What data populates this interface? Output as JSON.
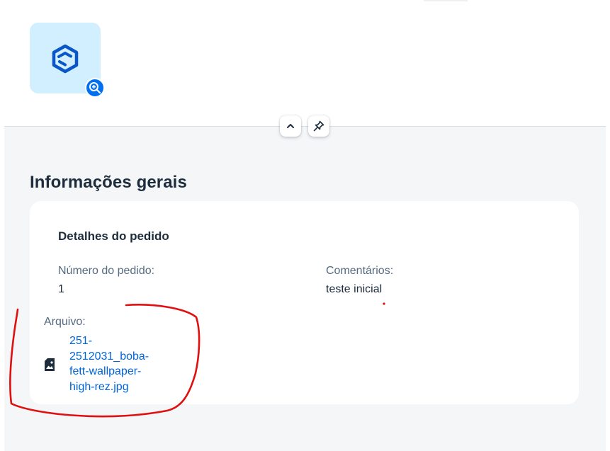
{
  "header": {
    "avatar_icon": "product-box-icon",
    "zoom_icon": "zoom-in-icon",
    "collapse_icon": "chevron-up-icon",
    "pin_icon": "pin-icon"
  },
  "section": {
    "title": "Informações gerais"
  },
  "card": {
    "title": "Detalhes do pedido",
    "fields": {
      "order_number": {
        "label": "Número do pedido:",
        "value": "1"
      },
      "comments": {
        "label": "Comentários:",
        "value": "teste inicial"
      },
      "file": {
        "label": "Arquivo:",
        "icon": "image-file-icon",
        "link_lines": [
          "251-",
          "2512031_boba-",
          "fett-wallpaper-",
          "high-rez.jpg"
        ]
      }
    }
  },
  "colors": {
    "accent": "#0070f2",
    "link": "#0064d9",
    "avatar_bg": "#d1efff",
    "annotation": "#e01010"
  }
}
